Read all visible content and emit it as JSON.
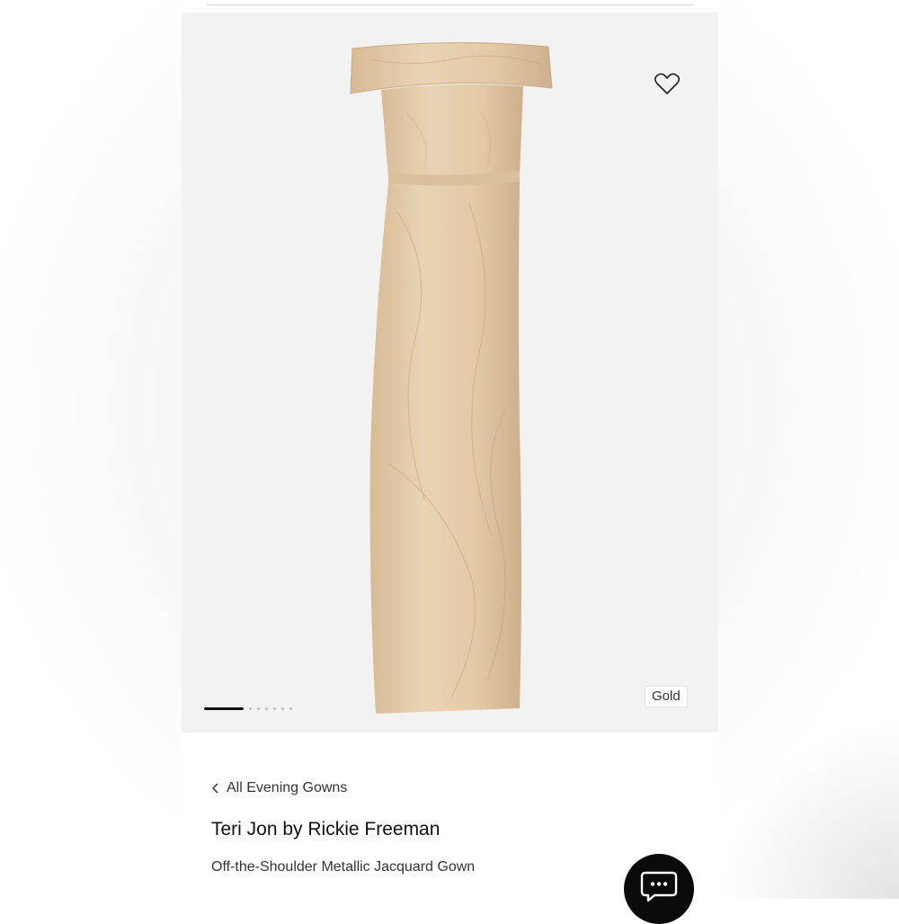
{
  "product_image": {
    "alt_subject": "gown-photo",
    "color_label": "Gold",
    "carousel": {
      "total_images": 7,
      "active_index": 0
    },
    "colors": {
      "gown": "#e2c9a8",
      "gown_shadow": "#cfb18b",
      "background": "#f2f2f2"
    }
  },
  "wishlist": {
    "icon": "heart-outline-icon"
  },
  "breadcrumb": {
    "label": "All Evening Gowns",
    "icon": "chevron-left-icon"
  },
  "product": {
    "brand": "Teri Jon by Rickie Freeman",
    "name": "Off-the-Shoulder Metallic Jacquard Gown"
  },
  "chat": {
    "icon": "chat-bubble-icon"
  }
}
